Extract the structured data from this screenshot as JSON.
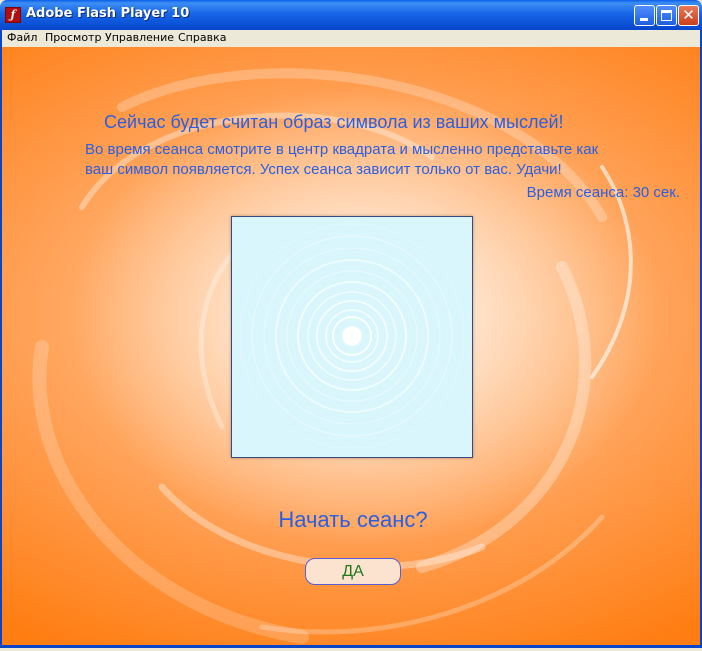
{
  "window": {
    "title": "Adobe Flash Player 10",
    "app_icon_glyph": "ƒ",
    "close_glyph": "✕"
  },
  "menu": {
    "items": [
      {
        "label": "Файл"
      },
      {
        "label": "Просмотр"
      },
      {
        "label": "Управление"
      },
      {
        "label": "Справка"
      }
    ]
  },
  "main": {
    "headline": "Сейчас будет считан образ символа из ваших мыслей!",
    "instruction_line1": "Во время сеанса смотрите в центр квадрата и мысленно представьте как",
    "instruction_line2": "ваш символ появляется. Успех сеанса зависит только от вас. Удачи!",
    "timer_text": "Время сеанса: 30 сек.",
    "prompt": "Начать сеанс?",
    "yes_button": "ДА"
  },
  "colors": {
    "text_blue": "#2b5fe0",
    "button_text_green": "#1c7a1c",
    "square_bg": "#d8f6fc",
    "orange": "#ff7300"
  }
}
